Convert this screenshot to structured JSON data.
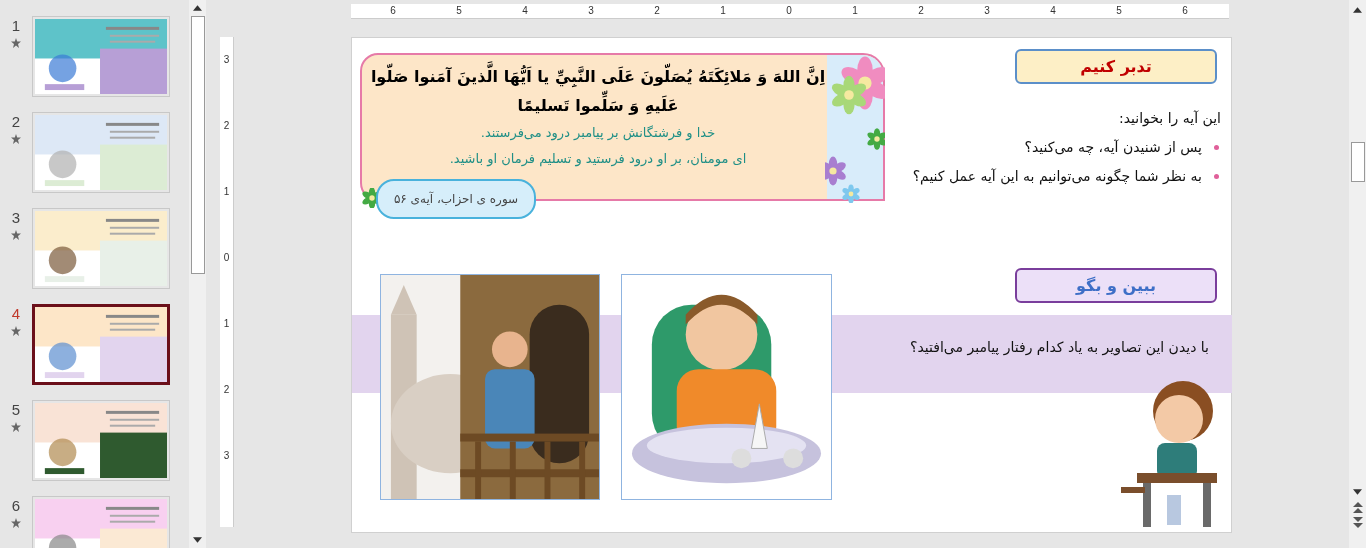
{
  "slide_panel": {
    "slides": [
      {
        "number": "1",
        "selected": false
      },
      {
        "number": "2",
        "selected": false
      },
      {
        "number": "3",
        "selected": false
      },
      {
        "number": "4",
        "selected": true
      },
      {
        "number": "5",
        "selected": false
      },
      {
        "number": "6",
        "selected": false
      }
    ]
  },
  "rulers": {
    "horizontal": [
      "6",
      "5",
      "4",
      "3",
      "2",
      "1",
      "0",
      "1",
      "2",
      "3",
      "4",
      "5",
      "6"
    ],
    "vertical": [
      "3",
      "2",
      "1",
      "0",
      "1",
      "2",
      "3"
    ]
  },
  "slide": {
    "verse_card": {
      "verse": "اِنَّ اللهَ وَ مَلائِكَتَهُ يُصَلّونَ عَلَى النَّبِيِّ يا اَيُّهَا الَّذينَ آمَنوا صَلّوا عَلَيهِ وَ سَلِّموا تَسليمًا",
      "translation": [
        "خدا و فرشتگانش بر پیامبر درود می‌فرستند.",
        "ای مومنان، بر او درود فرستید و تسلیم فرمان او باشید."
      ],
      "source": "سوره ی احزاب، آیه‌ی ۵۶"
    },
    "reflect": {
      "title": "تدبر کنیم",
      "intro": "این آیه را بخوانید:",
      "bullets": [
        "پس از شنیدن آیه، چه می‌کنید؟",
        "به نظر شما چگونه می‌توانیم به این آیه عمل کنیم؟"
      ]
    },
    "see_and_say": {
      "title": "ببین و بگو",
      "question": "با دیدن این تصاویر به یاد کدام رفتار پیامبر می‌افتید؟"
    }
  }
}
